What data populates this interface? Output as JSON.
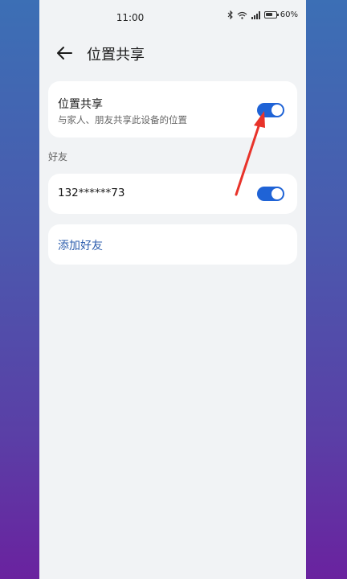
{
  "status_bar": {
    "time": "11:00",
    "battery": "60%",
    "icons": [
      "bluetooth-icon",
      "wifi-icon",
      "signal-icon",
      "battery-icon"
    ]
  },
  "header": {
    "title": "位置共享",
    "back_icon": "arrow-left-icon"
  },
  "location_sharing": {
    "title": "位置共享",
    "subtitle": "与家人、朋友共享此设备的位置",
    "enabled": true
  },
  "friends_section": {
    "label": "好友",
    "items": [
      {
        "name": "132******73",
        "enabled": true
      }
    ]
  },
  "add_friend": {
    "label": "添加好友"
  },
  "colors": {
    "accent": "#1f63d6",
    "link": "#2f5fae",
    "annotation_arrow": "#e8332a"
  }
}
